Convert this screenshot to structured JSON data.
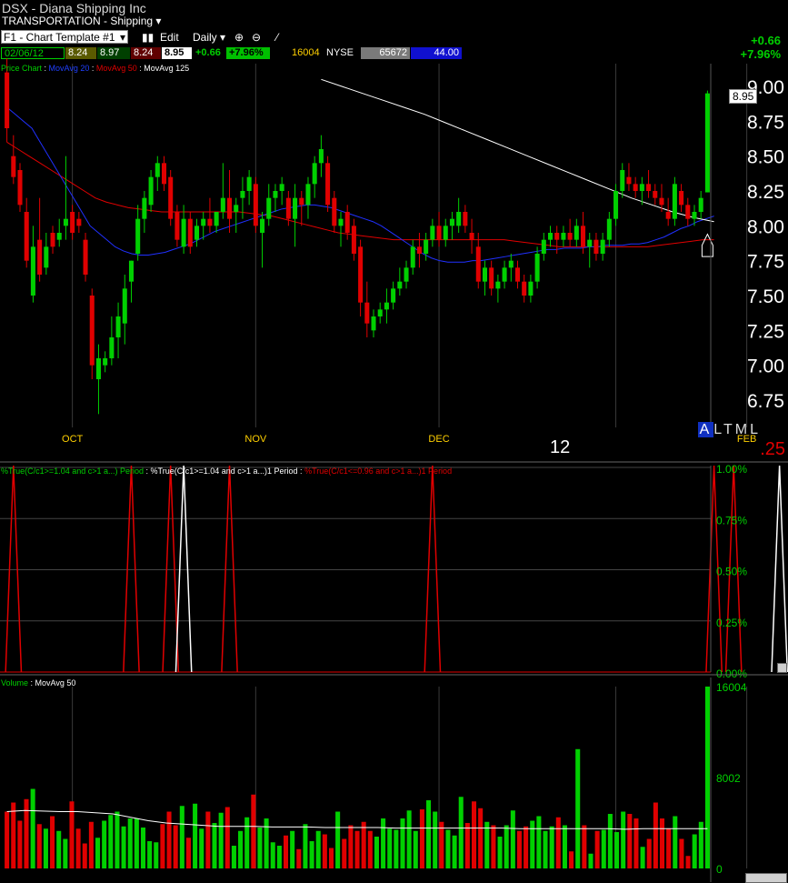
{
  "header": {
    "title": "DSX - Diana Shipping Inc",
    "sector": "TRANSPORTATION - Shipping",
    "template": "F1 - Chart Template #1",
    "edit_label": "Edit",
    "period_label": "Daily",
    "date": "02/06/12",
    "open": "8.24",
    "high": "8.97",
    "low": "8.24",
    "close": "8.95",
    "change": "+0.66",
    "change_pct": "+7.96%",
    "volume": "16004",
    "exchange": "NYSE",
    "field1": "65672",
    "field2": "44.00",
    "right_change": "+0.66",
    "right_change_pct": "+7.96%"
  },
  "colors": {
    "up": "#00d000",
    "down": "#e00000",
    "ma20": "#2030ff",
    "ma50": "#e00000",
    "ma125": "#ffffff",
    "grid": "#3a3a3a",
    "axis_text": "#ffffff",
    "month_text": "#ffd000"
  },
  "price_panel": {
    "legend": [
      "Price Chart",
      "MovAvg 20",
      "MovAvg 50",
      "MovAvg 125"
    ],
    "last_price_label": "8.95",
    "y_ticks": [
      "9.00",
      "8.75",
      "8.50",
      "8.25",
      "8.00",
      "7.75",
      "7.50",
      "7.25",
      "7.00",
      "6.75"
    ],
    "month_labels": [
      "OCT",
      "NOV",
      "DEC",
      "FEB"
    ],
    "year_label": "12",
    "indicator_letters": [
      "A",
      "L",
      "T",
      "M",
      "L"
    ],
    "indicator_value": ".25"
  },
  "indicator_panel": {
    "legend_a": "%True(C/c1>=1.04 and c>1 a...) Period",
    "legend_b": "%True(C/c1>=1.04 and c>1 a...)1 Period",
    "legend_c": "%True(C/c1<=0.96 and c>1 a...)1 Period",
    "y_ticks": [
      "1.00%",
      "0.75%",
      "0.50%",
      "0.25%",
      "0.00%"
    ]
  },
  "volume_panel": {
    "legend": [
      "Volume",
      "MovAvg 50"
    ],
    "y_ticks": [
      "16004",
      "8002",
      "0"
    ]
  },
  "chart_data": {
    "type": "candlestick",
    "title": "DSX - Diana Shipping Inc",
    "ylim": [
      6.6,
      9.1
    ],
    "x_months": {
      "OCT": 10,
      "NOV": 38,
      "DEC": 66,
      "12": 93,
      "FEB": 113
    },
    "candles": [
      [
        9.1,
        9.2,
        8.6,
        8.7
      ],
      [
        8.5,
        8.65,
        8.3,
        8.35
      ],
      [
        8.4,
        8.45,
        8.1,
        8.15
      ],
      [
        8.1,
        8.2,
        7.7,
        7.75
      ],
      [
        7.5,
        8.0,
        7.45,
        7.85
      ],
      [
        7.9,
        8.2,
        7.6,
        7.65
      ],
      [
        7.7,
        7.95,
        7.65,
        7.85
      ],
      [
        7.95,
        8.0,
        7.8,
        7.85
      ],
      [
        7.9,
        8.05,
        7.85,
        7.95
      ],
      [
        8.0,
        8.5,
        7.9,
        8.05
      ],
      [
        8.1,
        8.15,
        7.9,
        7.95
      ],
      [
        8.05,
        8.1,
        7.95,
        8.0
      ],
      [
        7.9,
        7.95,
        7.6,
        7.65
      ],
      [
        7.5,
        7.55,
        6.9,
        7.0
      ],
      [
        6.9,
        7.15,
        6.65,
        7.05
      ],
      [
        7.0,
        7.1,
        6.95,
        7.05
      ],
      [
        7.05,
        7.35,
        7.0,
        7.2
      ],
      [
        7.2,
        7.45,
        7.05,
        7.35
      ],
      [
        7.3,
        7.65,
        7.15,
        7.55
      ],
      [
        7.6,
        7.75,
        7.45,
        7.75
      ],
      [
        7.8,
        8.15,
        7.75,
        8.05
      ],
      [
        8.05,
        8.25,
        7.95,
        8.2
      ],
      [
        8.15,
        8.4,
        8.1,
        8.35
      ],
      [
        8.35,
        8.5,
        8.25,
        8.45
      ],
      [
        8.45,
        8.5,
        8.25,
        8.3
      ],
      [
        8.35,
        8.4,
        8.0,
        8.05
      ],
      [
        8.1,
        8.15,
        7.85,
        7.9
      ],
      [
        7.85,
        8.15,
        7.8,
        8.05
      ],
      [
        8.05,
        8.1,
        7.8,
        7.85
      ],
      [
        7.9,
        8.05,
        7.85,
        8.0
      ],
      [
        8.0,
        8.1,
        7.9,
        8.05
      ],
      [
        8.05,
        8.2,
        7.95,
        8.0
      ],
      [
        8.0,
        8.1,
        7.95,
        8.1
      ],
      [
        8.1,
        8.45,
        8.05,
        8.2
      ],
      [
        8.2,
        8.4,
        7.95,
        8.05
      ],
      [
        8.1,
        8.2,
        7.95,
        8.15
      ],
      [
        8.2,
        8.35,
        8.05,
        8.25
      ],
      [
        8.25,
        8.4,
        8.15,
        8.35
      ],
      [
        8.3,
        8.35,
        7.95,
        8.0
      ],
      [
        7.95,
        8.1,
        7.7,
        8.05
      ],
      [
        8.05,
        8.3,
        8.0,
        8.2
      ],
      [
        8.2,
        8.3,
        8.1,
        8.25
      ],
      [
        8.25,
        8.35,
        8.15,
        8.3
      ],
      [
        8.2,
        8.25,
        8.0,
        8.05
      ],
      [
        8.05,
        8.3,
        7.85,
        8.2
      ],
      [
        8.2,
        8.25,
        8.0,
        8.15
      ],
      [
        8.15,
        8.35,
        8.05,
        8.3
      ],
      [
        8.3,
        8.5,
        8.2,
        8.45
      ],
      [
        8.45,
        8.65,
        8.35,
        8.55
      ],
      [
        8.45,
        8.5,
        8.1,
        8.15
      ],
      [
        8.2,
        8.25,
        7.95,
        8.0
      ],
      [
        8.0,
        8.1,
        7.85,
        8.05
      ],
      [
        8.1,
        8.15,
        7.9,
        7.95
      ],
      [
        8.0,
        8.05,
        7.75,
        7.8
      ],
      [
        7.85,
        7.9,
        7.35,
        7.45
      ],
      [
        7.45,
        7.6,
        7.2,
        7.3
      ],
      [
        7.25,
        7.4,
        7.2,
        7.35
      ],
      [
        7.35,
        7.45,
        7.3,
        7.4
      ],
      [
        7.4,
        7.55,
        7.3,
        7.45
      ],
      [
        7.45,
        7.6,
        7.4,
        7.55
      ],
      [
        7.55,
        7.7,
        7.5,
        7.6
      ],
      [
        7.6,
        7.75,
        7.55,
        7.7
      ],
      [
        7.7,
        7.9,
        7.65,
        7.85
      ],
      [
        7.85,
        7.95,
        7.7,
        7.8
      ],
      [
        7.8,
        7.95,
        7.75,
        7.9
      ],
      [
        7.9,
        8.05,
        7.85,
        8.0
      ],
      [
        8.0,
        8.1,
        7.85,
        7.9
      ],
      [
        7.9,
        8.05,
        7.85,
        8.0
      ],
      [
        8.0,
        8.1,
        7.9,
        8.05
      ],
      [
        8.0,
        8.2,
        7.95,
        8.1
      ],
      [
        8.1,
        8.15,
        7.95,
        8.0
      ],
      [
        7.95,
        8.05,
        7.8,
        7.9
      ],
      [
        7.85,
        7.95,
        7.55,
        7.6
      ],
      [
        7.6,
        7.75,
        7.5,
        7.7
      ],
      [
        7.7,
        7.75,
        7.5,
        7.55
      ],
      [
        7.55,
        7.65,
        7.45,
        7.6
      ],
      [
        7.6,
        7.75,
        7.55,
        7.7
      ],
      [
        7.7,
        7.8,
        7.6,
        7.75
      ],
      [
        7.7,
        7.75,
        7.55,
        7.6
      ],
      [
        7.6,
        7.65,
        7.45,
        7.5
      ],
      [
        7.5,
        7.65,
        7.45,
        7.6
      ],
      [
        7.6,
        7.85,
        7.55,
        7.8
      ],
      [
        7.8,
        7.95,
        7.75,
        7.9
      ],
      [
        7.9,
        8.0,
        7.85,
        7.95
      ],
      [
        7.95,
        8.0,
        7.8,
        7.9
      ],
      [
        7.9,
        8.0,
        7.85,
        7.95
      ],
      [
        7.95,
        8.05,
        7.85,
        7.9
      ],
      [
        7.9,
        8.05,
        7.85,
        8.0
      ],
      [
        8.0,
        8.1,
        7.8,
        7.85
      ],
      [
        7.85,
        7.95,
        7.7,
        7.9
      ],
      [
        7.9,
        7.95,
        7.75,
        7.8
      ],
      [
        7.8,
        7.95,
        7.75,
        7.9
      ],
      [
        7.9,
        8.1,
        7.85,
        8.05
      ],
      [
        8.05,
        8.3,
        8.0,
        8.25
      ],
      [
        8.25,
        8.45,
        8.2,
        8.4
      ],
      [
        8.35,
        8.45,
        8.25,
        8.3
      ],
      [
        8.3,
        8.35,
        8.2,
        8.25
      ],
      [
        8.25,
        8.35,
        8.15,
        8.3
      ],
      [
        8.3,
        8.4,
        8.2,
        8.25
      ],
      [
        8.25,
        8.3,
        8.15,
        8.2
      ],
      [
        8.2,
        8.3,
        8.1,
        8.15
      ],
      [
        8.1,
        8.2,
        8.0,
        8.05
      ],
      [
        8.05,
        8.35,
        8.0,
        8.3
      ],
      [
        8.25,
        8.3,
        8.1,
        8.15
      ],
      [
        8.15,
        8.2,
        8.0,
        8.05
      ],
      [
        8.05,
        8.15,
        8.0,
        8.1
      ],
      [
        8.1,
        8.25,
        8.05,
        8.2
      ],
      [
        8.24,
        8.97,
        8.24,
        8.95
      ]
    ],
    "ma20": [
      8.85,
      8.8,
      8.75,
      8.7,
      8.6,
      8.5,
      8.4,
      8.3,
      8.2,
      8.1,
      8.0,
      7.95,
      7.9,
      7.85,
      7.82,
      7.8,
      7.79,
      7.79,
      7.8,
      7.81,
      7.83,
      7.85,
      7.87,
      7.9,
      7.93,
      7.96,
      7.98,
      8.0,
      8.02,
      8.04,
      8.06,
      8.08,
      8.1,
      8.12,
      8.13,
      8.14,
      8.15,
      8.15,
      8.14,
      8.13,
      8.11,
      8.09,
      8.07,
      8.05,
      8.03,
      8.0,
      7.96,
      7.92,
      7.88,
      7.84,
      7.8,
      7.77,
      7.75,
      7.74,
      7.74,
      7.74,
      7.75,
      7.75,
      7.76,
      7.77,
      7.78,
      7.79,
      7.8,
      7.81,
      7.82,
      7.83,
      7.83,
      7.84,
      7.84,
      7.84,
      7.85,
      7.85,
      7.86,
      7.86,
      7.86,
      7.87,
      7.87,
      7.88,
      7.9,
      7.92,
      7.95,
      7.98,
      8.0,
      8.03,
      8.05,
      8.07
    ],
    "ma50": [
      8.6,
      8.55,
      8.5,
      8.45,
      8.4,
      8.35,
      8.3,
      8.25,
      8.2,
      8.17,
      8.15,
      8.13,
      8.12,
      8.11,
      8.1,
      8.1,
      8.1,
      8.1,
      8.1,
      8.1,
      8.1,
      8.1,
      8.09,
      8.08,
      8.07,
      8.05,
      8.03,
      8.01,
      7.99,
      7.97,
      7.95,
      7.94,
      7.93,
      7.92,
      7.91,
      7.9,
      7.9,
      7.9,
      7.9,
      7.9,
      7.9,
      7.9,
      7.9,
      7.9,
      7.9,
      7.9,
      7.89,
      7.88,
      7.87,
      7.86,
      7.85,
      7.85,
      7.85,
      7.85,
      7.85,
      7.85,
      7.85,
      7.85,
      7.85,
      7.86,
      7.87,
      7.88,
      7.89,
      7.9,
      7.9
    ],
    "ma125": [
      9.05,
      9.0,
      8.95,
      8.9,
      8.85,
      8.8,
      8.74,
      8.68,
      8.62,
      8.56,
      8.5,
      8.44,
      8.38,
      8.32,
      8.26,
      8.2,
      8.15,
      8.1,
      8.06,
      8.03
    ],
    "indicator": {
      "ylim": [
        0,
        1.0
      ],
      "spikes_up_red": [
        1,
        19,
        25,
        34,
        65,
        108
      ],
      "spikes_down_red": [],
      "spikes_white": [
        27,
        118
      ],
      "spikes_red_b": [
        111
      ]
    },
    "volume": {
      "ylim": [
        0,
        16004
      ],
      "values": [
        5000,
        5800,
        4200,
        6100,
        7000,
        3900,
        3500,
        4600,
        3300,
        2600,
        5900,
        3500,
        2200,
        4100,
        2700,
        4200,
        4700,
        5000,
        3700,
        4400,
        4400,
        3600,
        2400,
        2300,
        3900,
        5000,
        3800,
        5500,
        2700,
        5700,
        3500,
        5000,
        4000,
        4900,
        5400,
        2000,
        3300,
        4500,
        6500,
        3600,
        4400,
        2300,
        2000,
        2900,
        3300,
        1700,
        3900,
        2400,
        3300,
        3000,
        1800,
        5000,
        2600,
        3800,
        3300,
        4100,
        3300,
        2800,
        4400,
        3500,
        3400,
        4400,
        5100,
        3300,
        5200,
        6000,
        5000,
        4100,
        3400,
        2900,
        6300,
        4000,
        5900,
        5300,
        4100,
        3800,
        2800,
        3800,
        5100,
        3300,
        3700,
        4200,
        4600,
        3300,
        3700,
        4500,
        3800,
        1500,
        10500,
        3800,
        1300,
        3300,
        3400,
        4800,
        3200,
        5000,
        4800,
        4400,
        1900,
        2600,
        5800,
        4400,
        3500,
        4600,
        2600,
        1100,
        3000,
        4100,
        16004
      ],
      "ma50": [
        5000,
        5100,
        5050,
        5000,
        5000,
        4900,
        4800,
        4500,
        4200,
        4000,
        3900,
        3800,
        3700,
        3700,
        3700,
        3650,
        3650,
        3650,
        3600,
        3600,
        3600,
        3600,
        3550,
        3550,
        3550,
        3550,
        3550,
        3550,
        3550,
        3500,
        3500,
        3500,
        3500,
        3500,
        3500,
        3450,
        3500,
        3500,
        3500,
        3500,
        3500
      ]
    }
  }
}
